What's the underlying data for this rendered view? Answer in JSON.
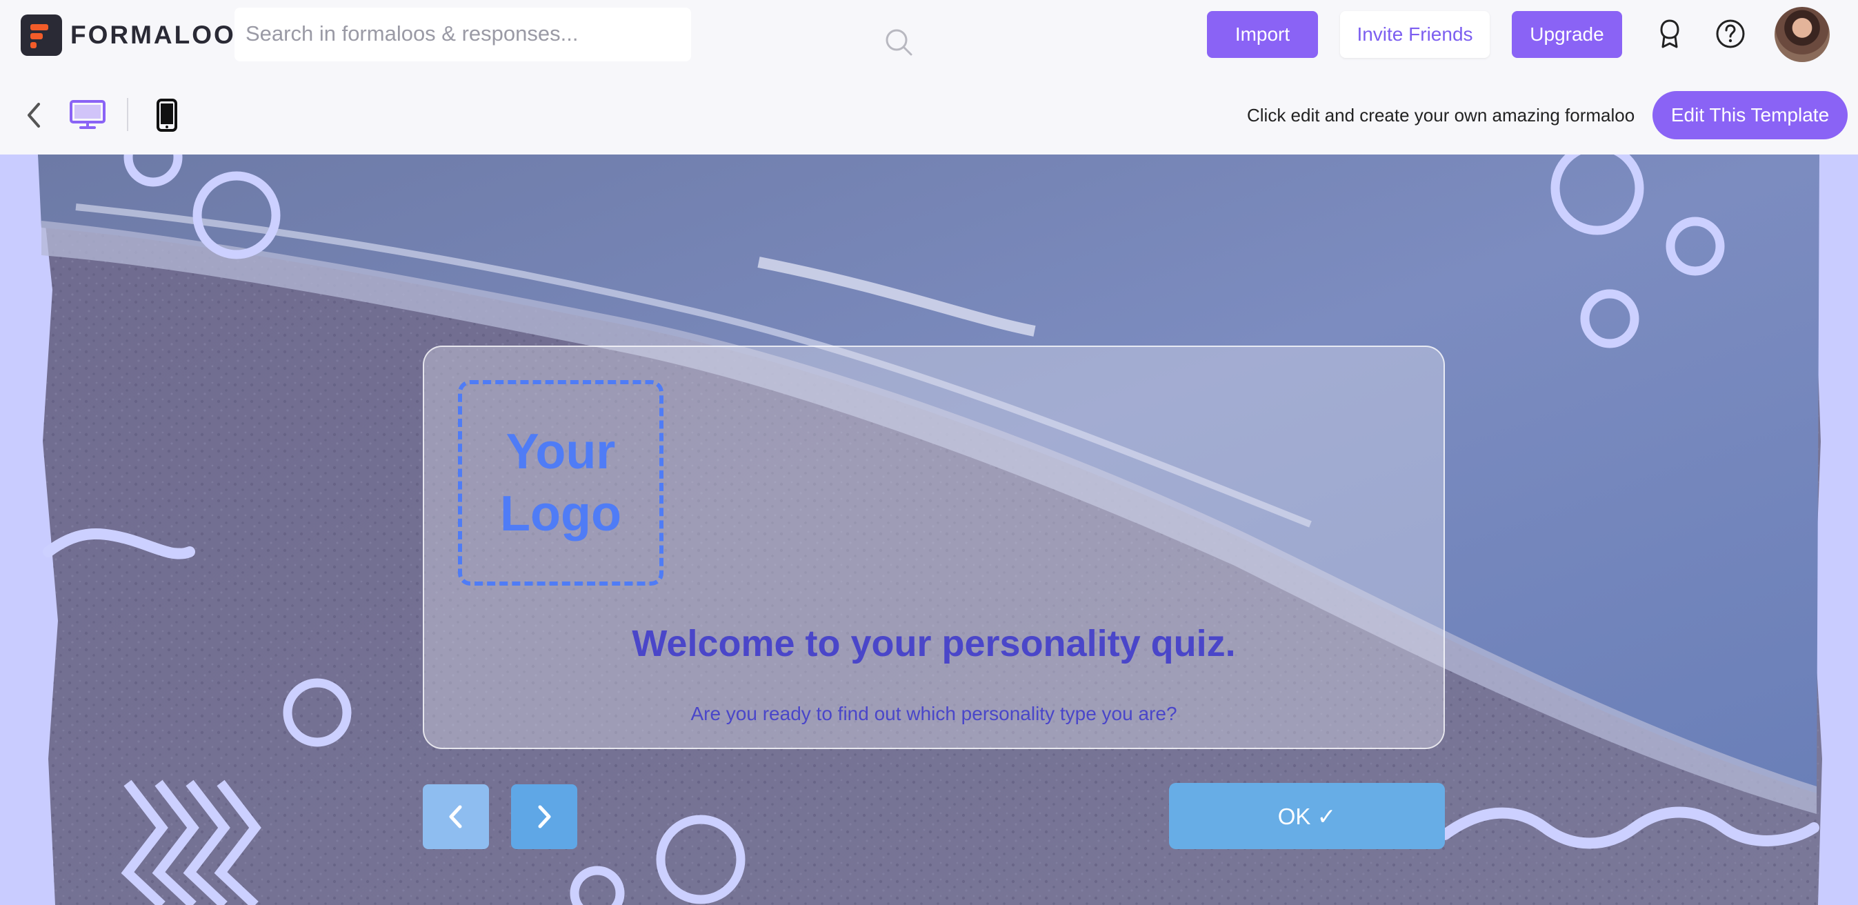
{
  "app": {
    "name": "FORMALOO"
  },
  "search": {
    "placeholder": "Search in formaloos & responses..."
  },
  "header": {
    "import_label": "Import",
    "invite_label": "Invite Friends",
    "upgrade_label": "Upgrade",
    "icons": [
      "badge-icon",
      "help-icon"
    ]
  },
  "toolbar": {
    "hint": "Click edit and create your own amazing formaloo",
    "edit_label": "Edit This Template",
    "view_modes": [
      "desktop",
      "mobile"
    ],
    "active_view": "desktop"
  },
  "form": {
    "logo_line1": "Your",
    "logo_line2": "Logo",
    "title": "Welcome to your personality quiz.",
    "subtitle": "Are you ready to find out which personality type you are?",
    "ok_label": "OK ✓"
  },
  "colors": {
    "accent": "#8a63f5",
    "title_text": "#4a46c9",
    "logo_placeholder": "#4f7cf6",
    "ok_button": "#67ade6",
    "canvas_background": "#c9ccff"
  }
}
